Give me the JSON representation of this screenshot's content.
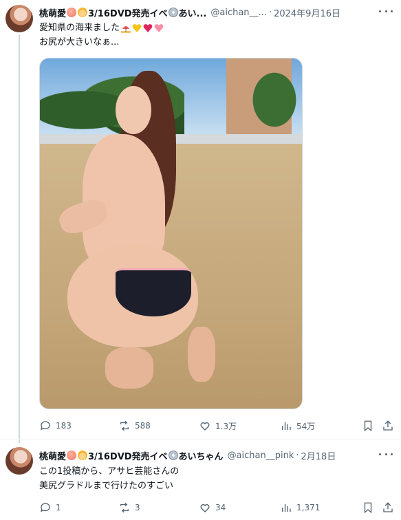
{
  "tweet1": {
    "author_name": "桃萌愛",
    "author_suffix": "3/16DVD発売イベ",
    "author_tail": "あい...",
    "handle": "@aichan__...",
    "date": "2024年9月16日",
    "text_line1": "愛知県の海来ました",
    "text_line2": "お尻が大きいなぁ...",
    "photo_alt": "",
    "stats": {
      "replies": "183",
      "retweets": "588",
      "likes": "1.3万",
      "views": "54万"
    }
  },
  "tweet2": {
    "author_name": "桃萌愛",
    "author_suffix": "3/16DVD発売イベ",
    "author_tail": "あいちゃん",
    "handle": "@aichan__pink",
    "date": "2月18日",
    "text_line1": "この1投稿から、アサヒ芸能さんの",
    "text_line2": "美尻グラドルまで行けたのすごい",
    "stats": {
      "replies": "1",
      "retweets": "3",
      "likes": "34",
      "views": "1,371"
    }
  },
  "icons": {
    "reply": "speech-bubble-icon",
    "retweet": "retweet-arrows-icon",
    "like": "heart-icon",
    "views": "bar-chart-icon",
    "bookmark": "bookmark-icon",
    "share": "share-upload-icon",
    "more": "ellipsis-icon"
  },
  "colors": {
    "text": "#0f1419",
    "secondary": "#536471",
    "thread_line": "#cfd9de"
  }
}
